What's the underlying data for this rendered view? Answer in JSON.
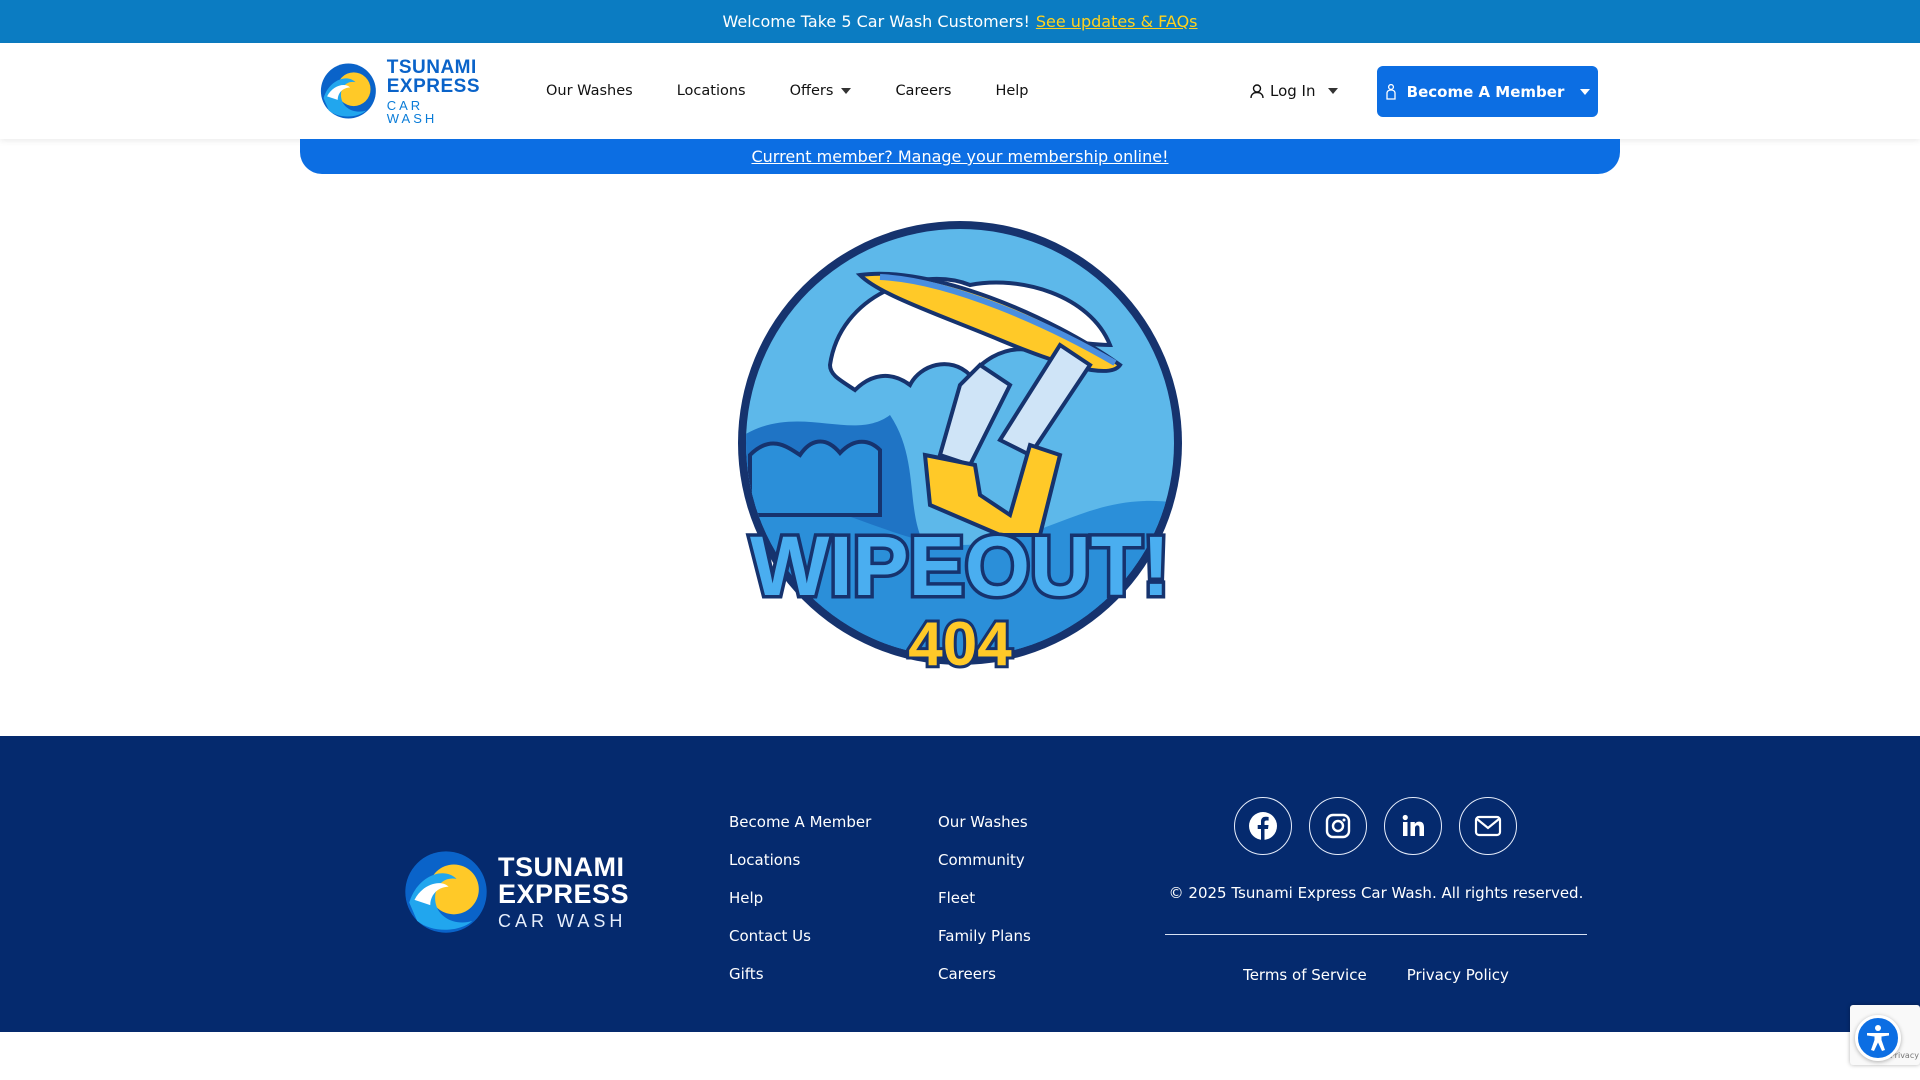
{
  "announcement": {
    "text": "Welcome Take 5 Car Wash Customers!",
    "link": "See updates & FAQs"
  },
  "brand": {
    "line1": "TSUNAMI",
    "line2": "EXPRESS",
    "line3": "CAR WASH"
  },
  "nav": {
    "items": [
      "Our Washes",
      "Locations",
      "Offers",
      "Careers",
      "Help"
    ]
  },
  "header": {
    "login_label": "Log In",
    "become_member_label": "Become A Member"
  },
  "member_bar": {
    "link": "Current member? Manage your membership online!"
  },
  "error_art": {
    "title": "WIPEOUT!",
    "code": "404"
  },
  "footer": {
    "col1": [
      "Become A Member",
      "Locations",
      "Help",
      "Contact Us",
      "Gifts"
    ],
    "col2": [
      "Our Washes",
      "Community",
      "Fleet",
      "Family Plans",
      "Careers"
    ],
    "socials": [
      "facebook-icon",
      "instagram-icon",
      "linkedin-icon",
      "mail-icon"
    ],
    "copyright": "© 2025 Tsunami Express Car Wash. All rights reserved.",
    "terms": "Terms of Service",
    "privacy": "Privacy Policy"
  },
  "recaptcha": {
    "text": "Privacy - Terms"
  },
  "colors": {
    "announce_bg": "#0b7cc2",
    "accent_yellow": "#ffd21f",
    "primary_blue": "#0c6ee3",
    "footer_bg": "#052a6e"
  }
}
